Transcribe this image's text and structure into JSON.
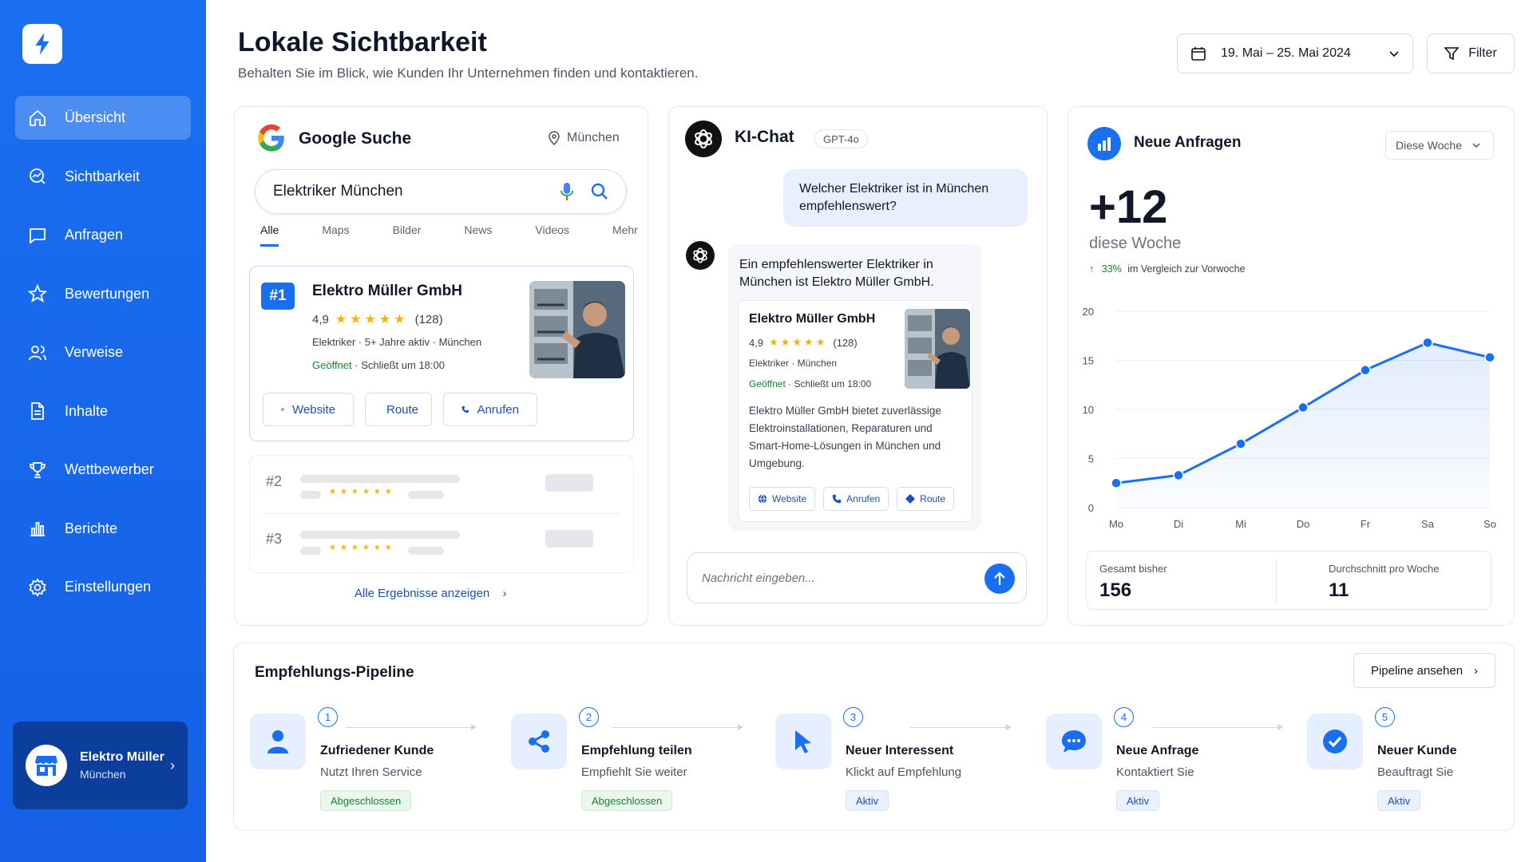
{
  "sidebar": {
    "items": [
      {
        "label": "Übersicht",
        "icon": "home-icon",
        "active": true
      },
      {
        "label": "Sichtbarkeit",
        "icon": "visibility-chart-icon"
      },
      {
        "label": "Anfragen",
        "icon": "message-icon"
      },
      {
        "label": "Bewertungen",
        "icon": "star-icon"
      },
      {
        "label": "Verweise",
        "icon": "users-icon"
      },
      {
        "label": "Inhalte",
        "icon": "document-icon"
      },
      {
        "label": "Wettbewerber",
        "icon": "trophy-icon"
      },
      {
        "label": "Berichte",
        "icon": "bar-chart-icon"
      },
      {
        "label": "Einstellungen",
        "icon": "gear-icon"
      }
    ],
    "business": {
      "name": "Elektro Müller",
      "city": "München"
    }
  },
  "header": {
    "title": "Lokale Sichtbarkeit",
    "subtitle": "Behalten Sie im Blick, wie Kunden Ihr Unternehmen finden und kontaktieren.",
    "date_range": "19. Mai – 25. Mai 2024",
    "filter_label": "Filter"
  },
  "google": {
    "title": "Google Suche",
    "location": "München",
    "query": "Elektriker München",
    "tabs": [
      "Alle",
      "Maps",
      "Bilder",
      "News",
      "Videos",
      "Mehr"
    ],
    "result": {
      "rank": "#1",
      "name": "Elektro Müller GmbH",
      "rating": "4,9",
      "stars": "★★★★★",
      "reviews": "(128)",
      "meta": "Elektriker  ·  5+ Jahre aktiv  ·  München",
      "open": "Geöffnet",
      "close_time": "·  Schließt um 18:00",
      "actions": [
        "Website",
        "Route",
        "Anrufen"
      ]
    },
    "others": [
      "#2",
      "#3"
    ],
    "mini_stars": "★★★★★★",
    "show_all": "Alle Ergebnisse anzeigen"
  },
  "ai": {
    "title": "KI-Chat",
    "model": "GPT-4o",
    "question": "Welcher Elektriker ist in München empfehlenswert?",
    "answer": "Ein empfehlenswerter Elektriker in München ist Elektro Müller GmbH.",
    "card": {
      "name": "Elektro Müller GmbH",
      "rating": "4,9",
      "stars": "★★★★★",
      "reviews": "(128)",
      "meta": "Elektriker  ·  München",
      "open": "Geöffnet",
      "close_time": "·  Schließt um 18:00",
      "description": "Elektro Müller GmbH bietet zuverlässige Elektroinstallationen, Reparaturen und Smart-Home-Lösungen in München und Umgebung.",
      "actions": [
        "Website",
        "Anrufen",
        "Route"
      ]
    },
    "input_placeholder": "Nachricht eingeben..."
  },
  "requests": {
    "title": "Neue Anfragen",
    "period": "Diese Woche",
    "value": "+12",
    "value_label": "diese Woche",
    "trend_pct": "33%",
    "trend_text": "im Vergleich zur Vorwoche",
    "total_label": "Gesamt bisher",
    "total_value": "156",
    "avg_label": "Durchschnitt pro Woche",
    "avg_value": "11"
  },
  "chart_data": {
    "type": "line",
    "categories": [
      "Mo",
      "Di",
      "Mi",
      "Do",
      "Fr",
      "Sa",
      "So"
    ],
    "values": [
      2.5,
      3.3,
      6.5,
      10.2,
      14,
      16.8,
      15.3
    ],
    "y_ticks": [
      "0",
      "5",
      "10",
      "15",
      "20"
    ],
    "ylim": [
      0,
      20
    ],
    "grid": true,
    "color": "#1a6ff0"
  },
  "pipeline": {
    "title": "Empfehlungs-Pipeline",
    "button": "Pipeline ansehen",
    "steps": [
      {
        "num": "1",
        "title": "Zufriedener Kunde",
        "desc": "Nutzt Ihren Service",
        "badge": "Abgeschlossen",
        "icon": "person-icon"
      },
      {
        "num": "2",
        "title": "Empfehlung teilen",
        "desc": "Empfiehlt Sie weiter",
        "badge": "Abgeschlossen",
        "icon": "share-icon"
      },
      {
        "num": "3",
        "title": "Neuer Interessent",
        "desc": "Klickt auf Empfehlung",
        "badge": "Aktiv",
        "icon": "cursor-icon"
      },
      {
        "num": "4",
        "title": "Neue Anfrage",
        "desc": "Kontaktiert Sie",
        "badge": "Aktiv",
        "icon": "chat-bubble-icon"
      },
      {
        "num": "5",
        "title": "Neuer Kunde",
        "desc": "Beauftragt Sie",
        "badge": "Aktiv",
        "icon": "check-circle-icon"
      }
    ]
  }
}
